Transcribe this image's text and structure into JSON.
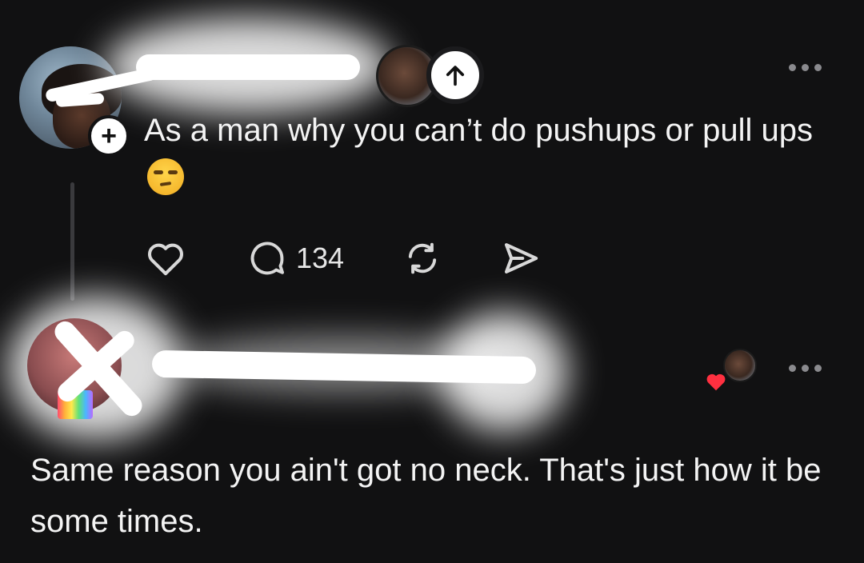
{
  "post": {
    "text": "As a man why you can’t do pushups or pull ups",
    "emoji": "unamused-face-emoji",
    "reply_count": "134",
    "icons": {
      "like": "heart-outline-icon",
      "comment": "speech-bubble-icon",
      "repost": "repost-icon",
      "share": "send-icon",
      "more": "more-dots-icon",
      "follow": "plus-icon",
      "scroll_up": "arrow-up-icon"
    }
  },
  "reply": {
    "text": "Same reason you ain't got no neck. That's just how it be some times.",
    "liked_by_author": true,
    "heart_color": "#ff3040"
  },
  "theme": {
    "background": "#111112",
    "text": "#f4f4f4",
    "muted": "#8a8a8e"
  }
}
